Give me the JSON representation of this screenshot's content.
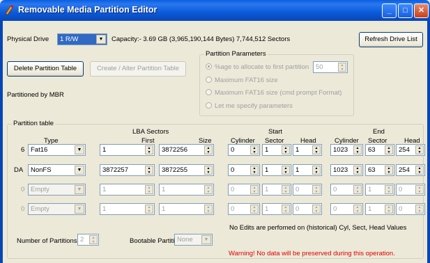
{
  "window": {
    "title": "Removable Media Partition Editor",
    "minimize": "_",
    "maximize": "□",
    "close": "✕"
  },
  "header": {
    "physical_drive_label": "Physical Drive",
    "physical_drive_value": "1 R/W",
    "capacity": "Capacity:- 3.69 GB (3,965,190,144 Bytes) 7,744,512 Sectors",
    "refresh_button": "Refresh Drive List"
  },
  "actions": {
    "delete_button": "Delete Partition Table",
    "create_button": "Create / Alter Partition Table",
    "partitioned_by": "Partitioned by MBR"
  },
  "params": {
    "legend": "Partition Parameters",
    "option1": "%age to allocate to first partition",
    "option1_value": "50",
    "option2": "Maximum FAT16 size",
    "option3": "Maximum FAT16 size (cmd prompt Format)",
    "option4": "Let me specify parameters"
  },
  "table": {
    "legend": "Partition table",
    "headers": {
      "type": "Type",
      "lba": "LBA Sectors",
      "first": "First",
      "size": "Size",
      "start": "Start",
      "end": "End",
      "cylinder": "Cylinder",
      "sector": "Sector",
      "head": "Head"
    },
    "rows": [
      {
        "code": "6",
        "type": "Fat16",
        "first": "1",
        "size": "3872256",
        "s_cyl": "0",
        "s_sec": "1",
        "s_head": "1",
        "e_cyl": "1023",
        "e_sec": "63",
        "e_head": "254",
        "enabled": true
      },
      {
        "code": "DA",
        "type": "NonFS",
        "first": "3872257",
        "size": "3872255",
        "s_cyl": "0",
        "s_sec": "1",
        "s_head": "1",
        "e_cyl": "1023",
        "e_sec": "63",
        "e_head": "254",
        "enabled": true
      },
      {
        "code": "0",
        "type": "Empty",
        "first": "1",
        "size": "1",
        "s_cyl": "0",
        "s_sec": "1",
        "s_head": "0",
        "e_cyl": "0",
        "e_sec": "1",
        "e_head": "0",
        "enabled": false
      },
      {
        "code": "0",
        "type": "Empty",
        "first": "1",
        "size": "1",
        "s_cyl": "0",
        "s_sec": "1",
        "s_head": "0",
        "e_cyl": "0",
        "e_sec": "1",
        "e_head": "0",
        "enabled": false
      }
    ],
    "note": "No Edits are perfomed on (historical) Cyl, Sect, Head Values",
    "num_partitions_label": "Number of Partitions",
    "num_partitions_value": "2",
    "bootable_label": "Bootable Partition",
    "bootable_value": "None",
    "warning": "Warning! No data will be preserved during this operation."
  },
  "colors": {
    "titlebar": "#0a5fe0",
    "window_bg": "#ece9d8",
    "warning": "#e00000"
  }
}
